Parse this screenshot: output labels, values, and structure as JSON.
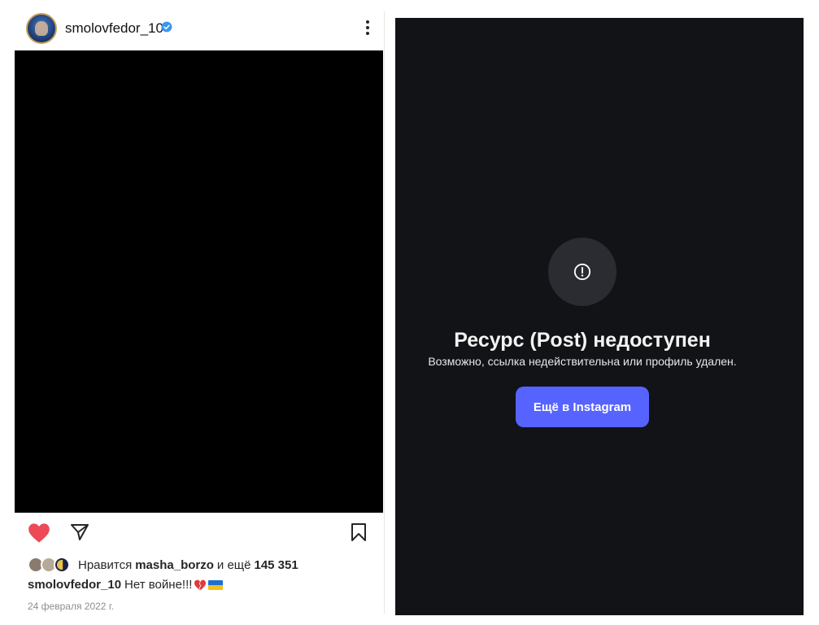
{
  "post": {
    "username": "smolovfedor_10",
    "likes": {
      "prefix": "Нравится",
      "user": "masha_borzo",
      "middle": "и ещё",
      "count": "145 351"
    },
    "caption": {
      "user": "smolovfedor_10",
      "text": "Нет войне!!!"
    },
    "date": "24 февраля 2022 г."
  },
  "error_panel": {
    "title": "Ресурс (Post) недоступен",
    "description": "Возможно, ссылка недействительна или профиль удален.",
    "button_label": "Ещё в Instagram"
  },
  "icons": {
    "verified": "verified-icon",
    "more": "more-icon",
    "like": "heart-icon",
    "share": "send-icon",
    "save": "bookmark-icon",
    "error": "alert-circle-icon",
    "broken_heart": "broken-heart-icon",
    "flag": "ukraine-flag-icon"
  },
  "colors": {
    "accent_button": "#5663ff",
    "like_red": "#ed4956",
    "verified_blue": "#3897f0",
    "error_bg": "#121317"
  }
}
